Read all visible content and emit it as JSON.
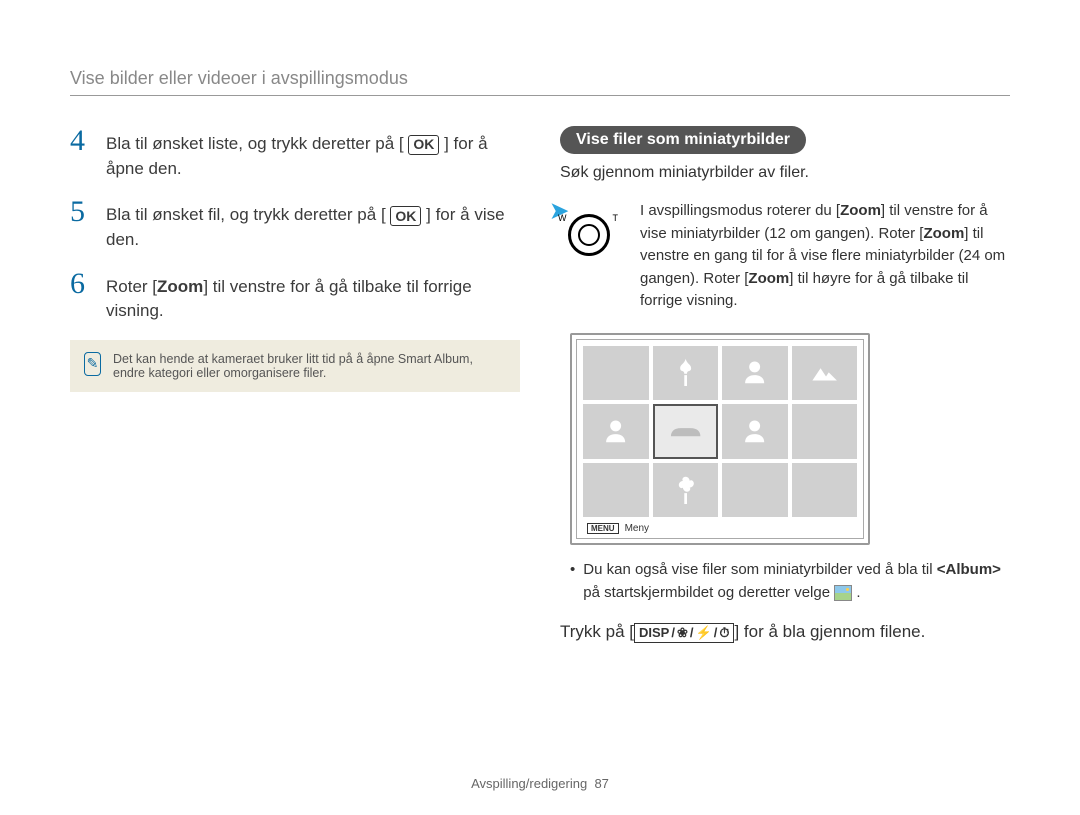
{
  "breadcrumb": "Vise bilder eller videoer i avspillingsmodus",
  "left": {
    "steps": [
      {
        "num": "4",
        "pre": "Bla til ønsket liste, og trykk deretter på [",
        "btn": "OK",
        "post": "] for å åpne den."
      },
      {
        "num": "5",
        "pre": "Bla til ønsket fil, og trykk deretter på [",
        "btn": "OK",
        "post": "] for å vise den."
      },
      {
        "num": "6",
        "pre": "Roter [",
        "bold": "Zoom",
        "post": "] til venstre for å gå tilbake til forrige visning."
      }
    ],
    "note": "Det kan hende at kameraet bruker litt tid på å åpne Smart Album, endre kategori eller omorganisere filer."
  },
  "right": {
    "pill": "Vise filer som miniatyrbilder",
    "sub": "Søk gjennom miniatyrbilder av filer.",
    "zoom": {
      "wLabel": "W",
      "tLabel": "T",
      "text_a": "I avspillingsmodus roterer du [",
      "zoom1": "Zoom",
      "text_b": "] til venstre for å vise miniatyrbilder (12 om gangen). Roter [",
      "zoom2": "Zoom",
      "text_c": "] til venstre en gang til for å vise flere miniatyrbilder (24 om gangen). Roter [",
      "zoom3": "Zoom",
      "text_d": "] til høyre for å gå tilbake til forrige visning."
    },
    "menuBtn": "MENU",
    "menuLabel": "Meny",
    "bullet_a": "Du kan også vise filer som miniatyrbilder ved å bla til ",
    "bullet_album": "<Album>",
    "bullet_b": " på startskjermbildet og deretter velge ",
    "bullet_c": " .",
    "instr_a": "Trykk på [",
    "instr_disp": "DISP",
    "instr_b": "] for å bla gjennom filene."
  },
  "footer": {
    "section": "Avspilling/redigering",
    "page": "87"
  }
}
